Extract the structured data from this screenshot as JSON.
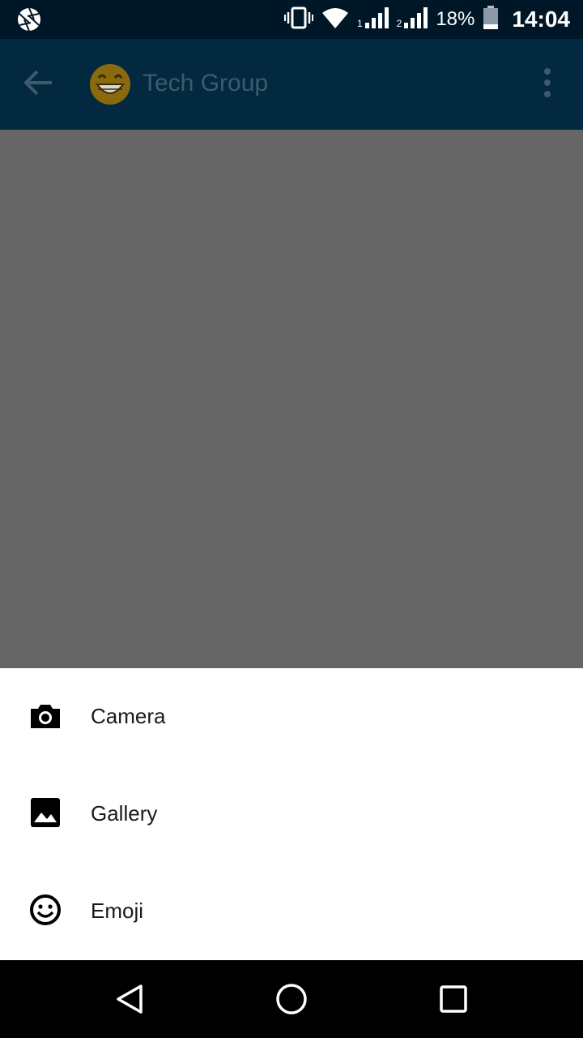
{
  "status_bar": {
    "left_icon": "camera-aperture-icon",
    "sim1_label": "1",
    "sim2_label": "2",
    "battery_percent": "18%",
    "time": "14:04",
    "icons": [
      "vibrate-icon",
      "wifi-icon",
      "signal-icon",
      "battery-icon"
    ]
  },
  "app_bar": {
    "back_icon": "arrow-back-icon",
    "group_name": "Tech Group",
    "avatar_icon": "grinning-emoji-avatar",
    "overflow_icon": "more-vert-icon"
  },
  "bottom_sheet": {
    "items": [
      {
        "label": "Camera",
        "icon": "camera-icon"
      },
      {
        "label": "Gallery",
        "icon": "image-icon"
      },
      {
        "label": "Emoji",
        "icon": "smiley-icon"
      }
    ]
  },
  "nav_bar": {
    "buttons": [
      "back-triangle-icon",
      "home-circle-icon",
      "recents-square-icon"
    ]
  },
  "colors": {
    "status_bar": "#001728",
    "app_bar": "#022940",
    "scrim": "#666666",
    "sheet": "#ffffff",
    "nav_bar": "#000000"
  }
}
